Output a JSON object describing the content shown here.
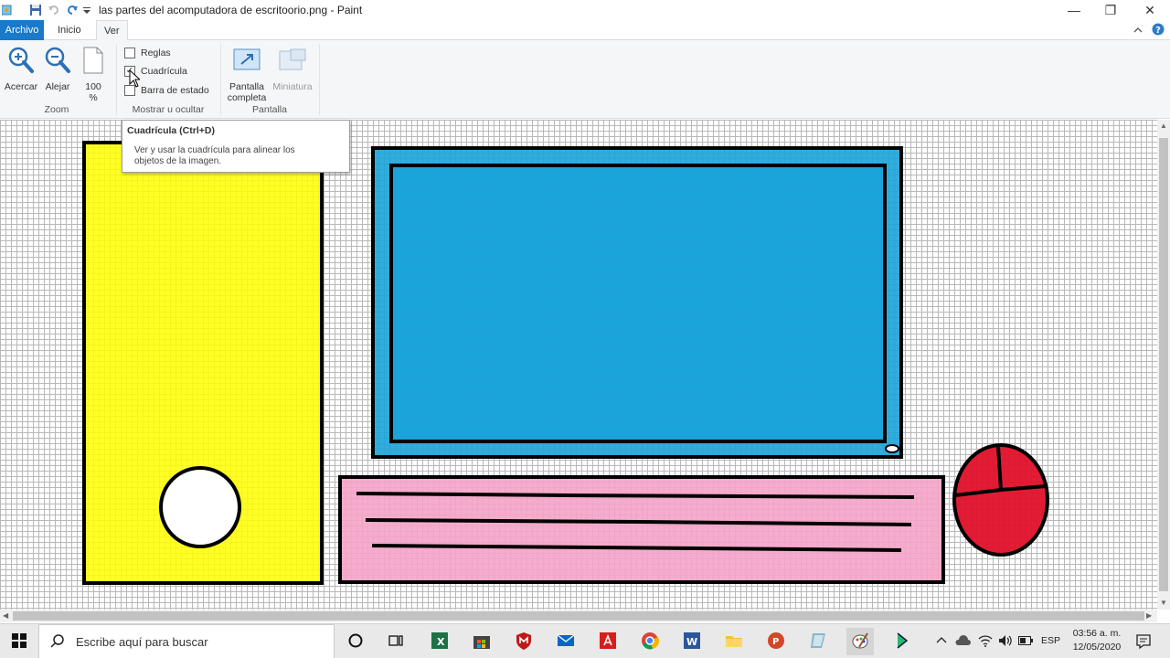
{
  "window": {
    "title": "las partes del acomputadora de escritoorio.png - Paint",
    "minimize_glyph": "—",
    "maximize_glyph": "❐",
    "close_glyph": "✕"
  },
  "tabs": [
    {
      "label": "Archivo"
    },
    {
      "label": "Inicio"
    },
    {
      "label": "Ver"
    }
  ],
  "ribbon": {
    "zoom": {
      "zoom_in_label": "Acercar",
      "zoom_out_label": "Alejar",
      "percent_line1": "100",
      "percent_line2": "%",
      "group_label": "Zoom"
    },
    "show_hide": {
      "rulers_label": "Reglas",
      "rulers_checked": false,
      "gridlines_label": "Cuadrícula",
      "gridlines_checked": true,
      "statusbar_label": "Barra de estado",
      "statusbar_checked": false,
      "group_label": "Mostrar u ocultar"
    },
    "display": {
      "fullscreen_line1": "Pantalla",
      "fullscreen_line2": "completa",
      "thumbnail_label": "Miniatura",
      "group_label": "Pantalla"
    }
  },
  "tooltip": {
    "title": "Cuadrícula (Ctrl+D)",
    "body": "Ver y usar la cuadrícula para alinear los objetos de la imagen."
  },
  "canvas": {
    "colors": {
      "tower": "#ffff00",
      "monitor": "#1aa3d9",
      "keyboard": "#f4a3c8",
      "mouse": "#e0102a",
      "outline": "#000000"
    }
  },
  "taskbar": {
    "search_placeholder": "Escribe aquí para buscar",
    "apps": [
      "cortana-icon",
      "task-view-icon",
      "excel-icon",
      "store-icon",
      "mcafee-icon",
      "mail-icon",
      "acrobat-icon",
      "chrome-icon",
      "word-icon",
      "file-explorer-icon",
      "powerpoint-icon",
      "notes-icon",
      "paint-icon",
      "media-app-icon"
    ],
    "language": "ESP",
    "time": "03:56 a. m.",
    "date": "12/05/2020"
  }
}
